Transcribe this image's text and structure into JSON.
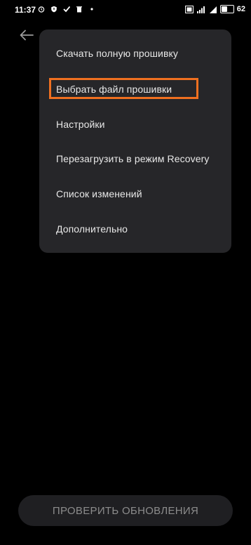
{
  "status_bar": {
    "time": "11:37",
    "battery_percent": 62,
    "battery_label": "62",
    "icons_left": [
      "alarm-icon",
      "shield-icon",
      "check-icon",
      "trash-icon",
      "dot-icon"
    ],
    "icons_right": [
      "screenshot-icon",
      "signal-icon",
      "signal-icon",
      "battery-icon"
    ]
  },
  "menu": {
    "items": [
      {
        "label": "Скачать полную прошивку"
      },
      {
        "label": "Выбрать файл прошивки"
      },
      {
        "label": "Настройки"
      },
      {
        "label": "Перезагрузить в режим Recovery"
      },
      {
        "label": "Список изменений"
      },
      {
        "label": "Дополнительно"
      }
    ],
    "highlight_color": "#f07020"
  },
  "bottom_button": {
    "label": "ПРОВЕРИТЬ ОБНОВЛЕНИЯ"
  }
}
